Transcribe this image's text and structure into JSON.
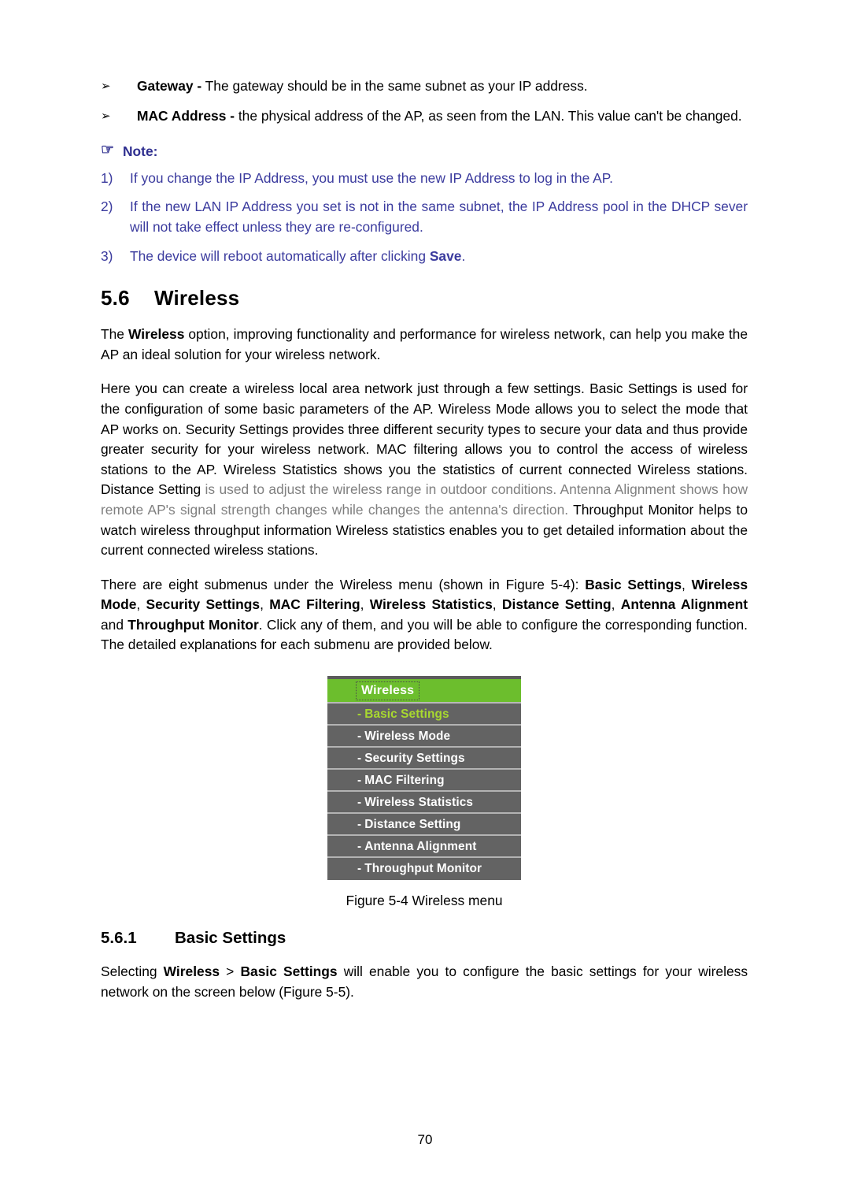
{
  "document": {
    "page_number": "70"
  },
  "bullets": [
    {
      "marker": "➢",
      "term": "Gateway -",
      "text": " The gateway should be in the same subnet as your IP address."
    },
    {
      "marker": "➢",
      "term": "MAC Address -",
      "text": " the physical address of the AP, as seen from the LAN. This value can't be changed."
    }
  ],
  "note": {
    "icon": "pointing-hand-icon",
    "icon_glyph": "☞",
    "heading": "Note:",
    "items": [
      {
        "number": "1)",
        "text": "If you change the IP Address, you must use the new IP Address to log in the AP.",
        "text_before_bold": "",
        "bold": "",
        "text_after_bold": ""
      },
      {
        "number": "2)",
        "text": "If the new LAN IP Address you set is not in the same subnet, the IP Address pool in the DHCP sever will not take effect unless they are re-configured.",
        "text_before_bold": "",
        "bold": "",
        "text_after_bold": ""
      },
      {
        "number": "3)",
        "text": "",
        "text_before_bold": "The device will reboot automatically after clicking ",
        "bold": "Save",
        "text_after_bold": "."
      }
    ]
  },
  "section": {
    "number": "5.6",
    "title": "Wireless"
  },
  "paragraph1": {
    "before_bold": "The ",
    "bold": "Wireless",
    "after_bold": " option, improving functionality and performance for wireless network, can help you make the AP an ideal solution for your wireless network."
  },
  "paragraph2": {
    "black_part": "Here you can create a wireless local area network just through a few settings. Basic Settings is used for the configuration of some basic parameters of the AP. Wireless Mode allows you to select the mode that AP works on. Security Settings provides three different security types to secure your data and thus provide greater security for your wireless network. MAC filtering allows you to control the access of wireless stations to the AP. Wireless Statistics shows you the statistics of current connected Wireless stations. Distance Setting ",
    "gray_part": "is used to adjust the wireless range in outdoor conditions. Antenna Alignment shows how remote AP's signal strength changes while changes the antenna's direction. ",
    "black_part2": "Throughput Monitor helps to watch wireless throughput information Wireless statistics enables you to get detailed information about the current connected wireless stations."
  },
  "paragraph3": {
    "intro": "There are eight submenus under the Wireless menu (shown in Figure 5-4): ",
    "items_bold": [
      "Basic Settings",
      "Wireless Mode",
      "Security Settings",
      "MAC Filtering",
      "Wireless Statistics",
      "Distance Setting",
      "Antenna Alignment",
      "Throughput Monitor"
    ],
    "conjunction": " and ",
    "outro": ". Click any of them, and you will be able to configure the corresponding function. The detailed explanations for each submenu are provided below."
  },
  "wireless_menu": {
    "header": "Wireless",
    "header_color": "#6cbe2d",
    "row_color": "#636363",
    "active_color": "#a8d92f",
    "items": [
      {
        "dash": "-",
        "label": "Basic Settings",
        "active": true
      },
      {
        "dash": "-",
        "label": "Wireless Mode",
        "active": false
      },
      {
        "dash": "-",
        "label": "Security Settings",
        "active": false
      },
      {
        "dash": "-",
        "label": "MAC Filtering",
        "active": false
      },
      {
        "dash": "-",
        "label": "Wireless Statistics",
        "active": false
      },
      {
        "dash": "-",
        "label": "Distance Setting",
        "active": false
      },
      {
        "dash": "-",
        "label": "Antenna Alignment",
        "active": false
      },
      {
        "dash": "-",
        "label": "Throughput Monitor",
        "active": false
      }
    ]
  },
  "figure_caption": "Figure 5-4 Wireless menu",
  "subsection": {
    "number": "5.6.1",
    "title": "Basic Settings"
  },
  "paragraph4": {
    "before_bold1": "Selecting ",
    "bold1": "Wireless",
    "between": " > ",
    "bold2": "Basic Settings",
    "after": " will enable you to configure the basic settings for your wireless network on the screen below (Figure 5-5)."
  }
}
